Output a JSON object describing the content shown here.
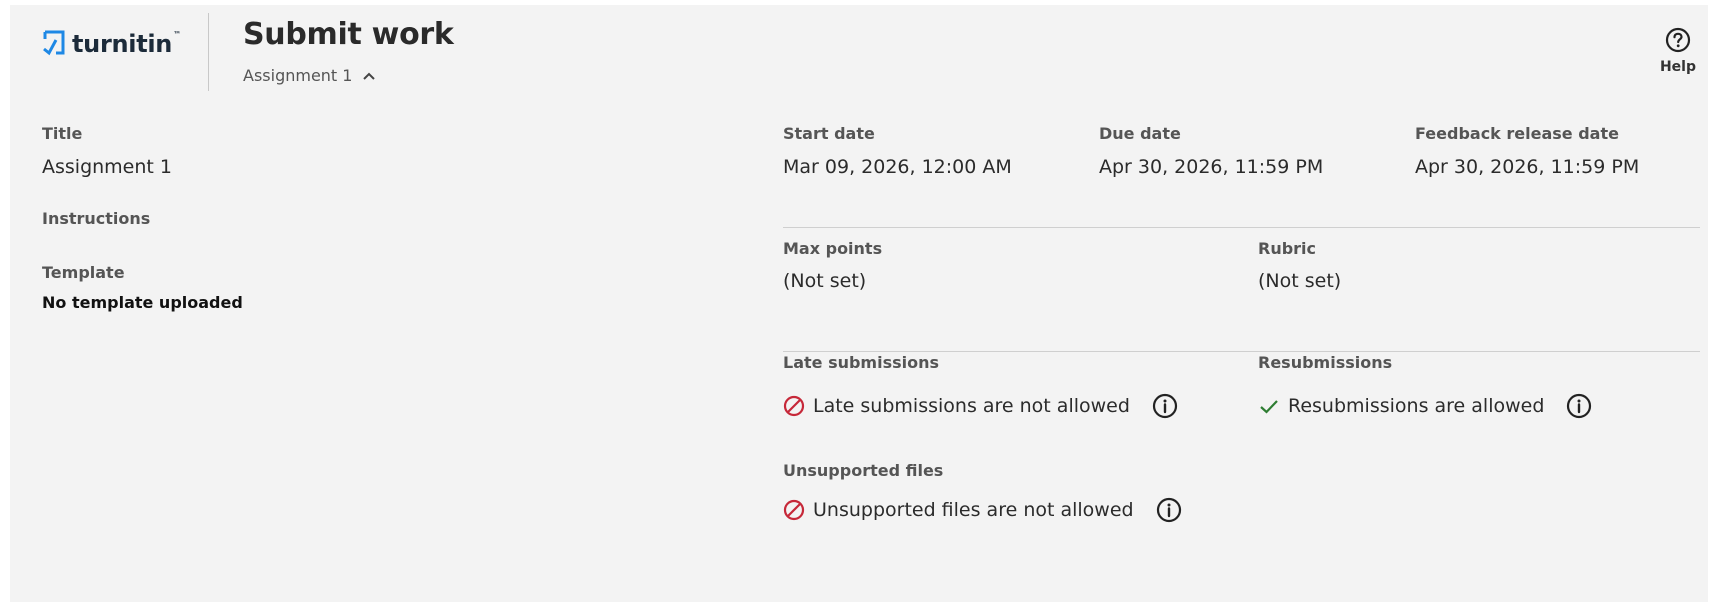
{
  "header": {
    "brand": "turnitin",
    "brand_tm": "™",
    "title": "Submit work",
    "assignment_toggle_label": "Assignment 1",
    "help_label": "Help"
  },
  "left": {
    "title_label": "Title",
    "title_value": "Assignment 1",
    "instructions_label": "Instructions",
    "template_label": "Template",
    "template_value": "No template uploaded"
  },
  "dates": {
    "start_label": "Start date",
    "start_value": "Mar 09, 2026, 12:00 AM",
    "due_label": "Due date",
    "due_value": "Apr 30, 2026, 11:59 PM",
    "feedback_label": "Feedback release date",
    "feedback_value": "Apr 30, 2026, 11:59 PM"
  },
  "grading": {
    "max_points_label": "Max points",
    "max_points_value": "(Not set)",
    "rubric_label": "Rubric",
    "rubric_value": "(Not set)"
  },
  "policies": {
    "late_label": "Late submissions",
    "late_value": "Late submissions are not allowed",
    "late_icon": "not-allowed-icon",
    "resub_label": "Resubmissions",
    "resub_value": "Resubmissions are allowed",
    "resub_icon": "checkmark-icon",
    "unsupported_label": "Unsupported files",
    "unsupported_value": "Unsupported files are not allowed",
    "unsupported_icon": "not-allowed-icon"
  },
  "colors": {
    "background": "#f3f3f3",
    "brand_blue": "#1e88e5",
    "not_allowed_red": "#c62839",
    "allowed_green": "#2e7d32"
  }
}
